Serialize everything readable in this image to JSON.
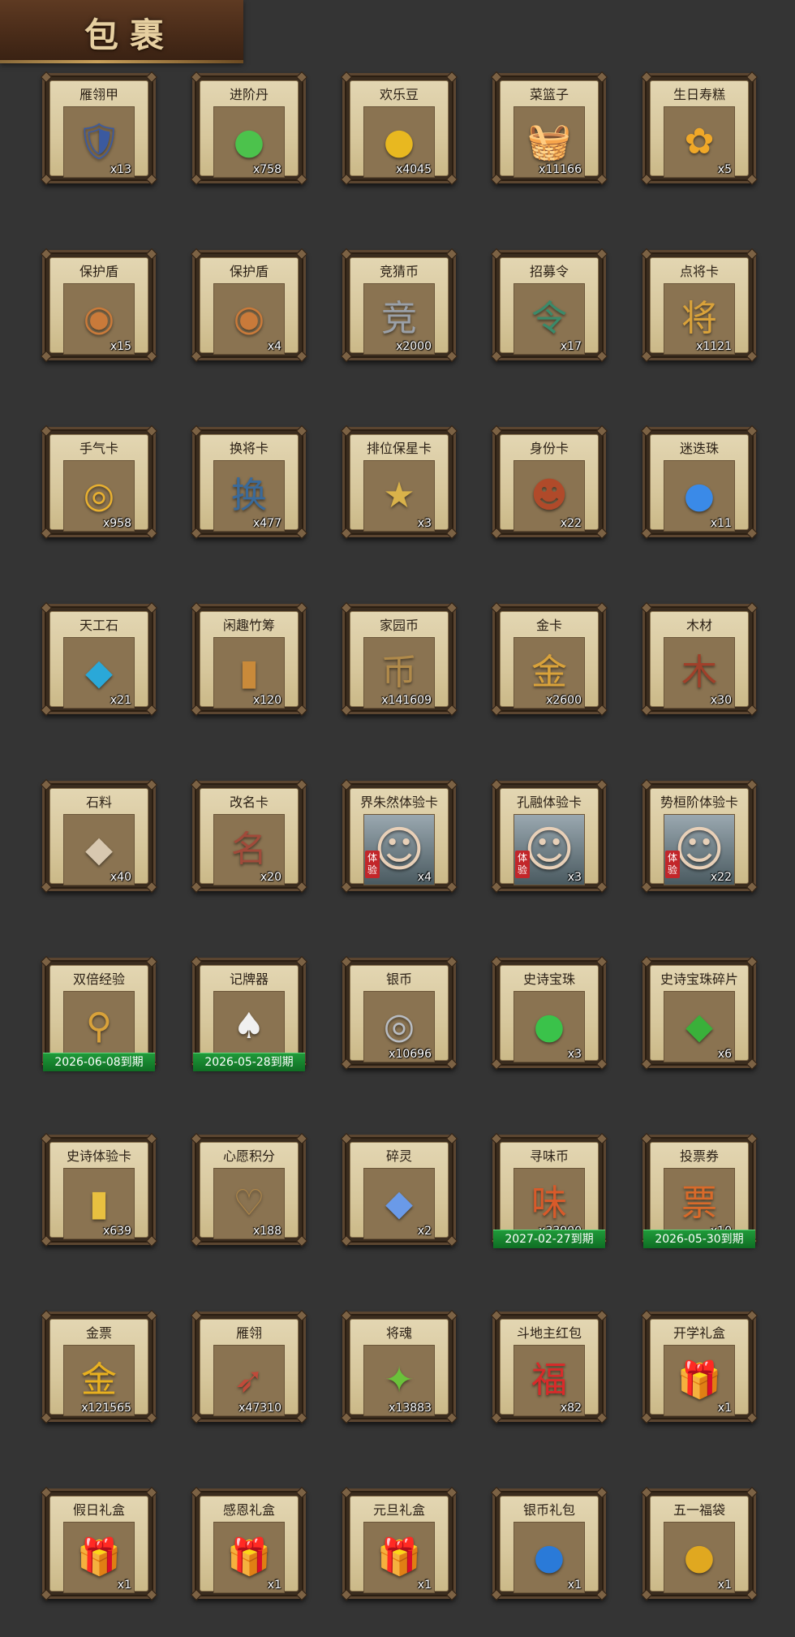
{
  "title": "包裹",
  "items": [
    {
      "name": "雁翎甲",
      "qty": "x13",
      "icon": "armor-icon",
      "glyph": "🛡",
      "color": "#3b5aa0"
    },
    {
      "name": "进阶丹",
      "qty": "x758",
      "icon": "advance-pill-icon",
      "glyph": "●",
      "color": "#4cc24c"
    },
    {
      "name": "欢乐豆",
      "qty": "x4045",
      "icon": "happy-beans-icon",
      "glyph": "●",
      "color": "#e8b820"
    },
    {
      "name": "菜篮子",
      "qty": "x11166",
      "icon": "vegetable-basket-icon",
      "glyph": "🧺",
      "color": "#c98a3a"
    },
    {
      "name": "生日寿糕",
      "qty": "x5",
      "icon": "birthday-cake-icon",
      "glyph": "✿",
      "color": "#f0a828"
    },
    {
      "name": "保护盾",
      "qty": "x15",
      "icon": "shield-icon",
      "glyph": "◉",
      "color": "#c97a3a"
    },
    {
      "name": "保护盾",
      "qty": "x4",
      "icon": "shield-icon",
      "glyph": "◉",
      "color": "#c97a3a"
    },
    {
      "name": "竞猜币",
      "qty": "x2000",
      "icon": "guess-coin-icon",
      "glyph": "竞",
      "color": "#9aa0a8"
    },
    {
      "name": "招募令",
      "qty": "x17",
      "icon": "recruit-token-icon",
      "glyph": "令",
      "color": "#3a8a6a"
    },
    {
      "name": "点将卡",
      "qty": "x1121",
      "icon": "general-card-icon",
      "glyph": "将",
      "color": "#d9a23a"
    },
    {
      "name": "手气卡",
      "qty": "x958",
      "icon": "luck-card-icon",
      "glyph": "◎",
      "color": "#e8b030"
    },
    {
      "name": "换将卡",
      "qty": "x477",
      "icon": "swap-general-card-icon",
      "glyph": "换",
      "color": "#3a6a9a"
    },
    {
      "name": "排位保星卡",
      "qty": "x3",
      "icon": "rank-protect-card-icon",
      "glyph": "★",
      "color": "#d9b24a"
    },
    {
      "name": "身份卡",
      "qty": "x22",
      "icon": "identity-card-icon",
      "glyph": "☻",
      "color": "#b04a2a"
    },
    {
      "name": "迷迭珠",
      "qty": "x11",
      "icon": "blue-orb-icon",
      "glyph": "●",
      "color": "#3a8ae8"
    },
    {
      "name": "天工石",
      "qty": "x21",
      "icon": "crystal-stone-icon",
      "glyph": "◆",
      "color": "#2aa8d8"
    },
    {
      "name": "闲趣竹筹",
      "qty": "x120",
      "icon": "bamboo-token-icon",
      "glyph": "▮",
      "color": "#c98a3a"
    },
    {
      "name": "家园币",
      "qty": "x141609",
      "icon": "home-coin-icon",
      "glyph": "币",
      "color": "#b08a4a"
    },
    {
      "name": "金卡",
      "qty": "x2600",
      "icon": "gold-card-icon",
      "glyph": "金",
      "color": "#d9a23a"
    },
    {
      "name": "木材",
      "qty": "x30",
      "icon": "wood-icon",
      "glyph": "木",
      "color": "#a0402a"
    },
    {
      "name": "石料",
      "qty": "x40",
      "icon": "stone-icon",
      "glyph": "◆",
      "color": "#d8c8b0"
    },
    {
      "name": "改名卡",
      "qty": "x20",
      "icon": "rename-card-icon",
      "glyph": "名",
      "color": "#a04a3a"
    },
    {
      "name": "界朱然体验卡",
      "qty": "x4",
      "icon": "hero-portrait-icon",
      "glyph": "☺",
      "color": "#5a6a5a",
      "trial": "体验"
    },
    {
      "name": "孔融体验卡",
      "qty": "x3",
      "icon": "hero-portrait-icon",
      "glyph": "☺",
      "color": "#8a5a3a",
      "trial": "体验"
    },
    {
      "name": "势桓阶体验卡",
      "qty": "x22",
      "icon": "hero-portrait-icon",
      "glyph": "☺",
      "color": "#5a4a3a",
      "trial": "体验"
    },
    {
      "name": "双倍经验",
      "qty": "",
      "icon": "double-exp-icon",
      "glyph": "⚲",
      "color": "#d9a23a",
      "expiry": "2026-06-08到期"
    },
    {
      "name": "记牌器",
      "qty": "",
      "icon": "card-counter-icon",
      "glyph": "♠",
      "color": "#f0f0f0",
      "expiry": "2026-05-28到期"
    },
    {
      "name": "银币",
      "qty": "x10696",
      "icon": "silver-coin-icon",
      "glyph": "◎",
      "color": "#b8bcc2"
    },
    {
      "name": "史诗宝珠",
      "qty": "x3",
      "icon": "epic-orb-icon",
      "glyph": "●",
      "color": "#3ac24a"
    },
    {
      "name": "史诗宝珠碎片",
      "qty": "x6",
      "icon": "epic-orb-fragment-icon",
      "glyph": "◆",
      "color": "#3ab03a"
    },
    {
      "name": "史诗体验卡",
      "qty": "x639",
      "icon": "epic-trial-card-icon",
      "glyph": "▮",
      "color": "#e8c040"
    },
    {
      "name": "心愿积分",
      "qty": "x188",
      "icon": "wish-points-icon",
      "glyph": "♡",
      "color": "#b0884a"
    },
    {
      "name": "碎灵",
      "qty": "x2",
      "icon": "spirit-shard-icon",
      "glyph": "◆",
      "color": "#6a9ae8"
    },
    {
      "name": "寻味币",
      "qty": "x33900",
      "icon": "flavor-coin-icon",
      "glyph": "味",
      "color": "#d85a2a",
      "expiry": "2027-02-27到期"
    },
    {
      "name": "投票券",
      "qty": "x10",
      "icon": "vote-ticket-icon",
      "glyph": "票",
      "color": "#d86a2a",
      "expiry": "2026-05-30到期"
    },
    {
      "name": "金票",
      "qty": "x121565",
      "icon": "gold-ticket-icon",
      "glyph": "金",
      "color": "#e8b020"
    },
    {
      "name": "雁翎",
      "qty": "x47310",
      "icon": "feather-icon",
      "glyph": "➶",
      "color": "#c04a3a"
    },
    {
      "name": "将魂",
      "qty": "x13883",
      "icon": "general-soul-icon",
      "glyph": "✦",
      "color": "#6ac23a"
    },
    {
      "name": "斗地主红包",
      "qty": "x82",
      "icon": "red-envelope-icon",
      "glyph": "福",
      "color": "#d82a2a"
    },
    {
      "name": "开学礼盒",
      "qty": "x1",
      "icon": "gift-box-icon",
      "glyph": "🎁",
      "color": "#a04a9a"
    },
    {
      "name": "假日礼盒",
      "qty": "x1",
      "icon": "gift-box-icon",
      "glyph": "🎁",
      "color": "#d83a3a"
    },
    {
      "name": "感恩礼盒",
      "qty": "x1",
      "icon": "gift-box-icon",
      "glyph": "🎁",
      "color": "#3a6ab0"
    },
    {
      "name": "元旦礼盒",
      "qty": "x1",
      "icon": "gift-box-icon",
      "glyph": "🎁",
      "color": "#3a6ab0"
    },
    {
      "name": "银币礼包",
      "qty": "x1",
      "icon": "silver-pouch-icon",
      "glyph": "●",
      "color": "#2a7ad8"
    },
    {
      "name": "五一福袋",
      "qty": "x1",
      "icon": "lucky-bag-icon",
      "glyph": "●",
      "color": "#e0a820"
    }
  ]
}
